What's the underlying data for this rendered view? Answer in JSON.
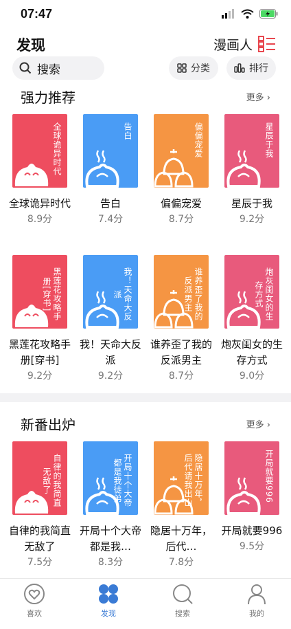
{
  "status": {
    "time": "07:47"
  },
  "header": {
    "title": "发现",
    "manhua_label": "漫画人",
    "search_placeholder": "搜索",
    "category_label": "分类",
    "rank_label": "排行"
  },
  "colors": {
    "red": "#ee4d5f",
    "blue": "#4a9cf5",
    "orange": "#f59543",
    "pink": "#e85a7c",
    "accent": "#3a7bd5"
  },
  "sections": [
    {
      "title": "强力推荐",
      "more": "更多",
      "books": [
        {
          "cover_title": "全球诡异时代",
          "name": "全球诡异时代",
          "score": "8.9分",
          "color": "red",
          "icon": "bun-icon"
        },
        {
          "cover_title": "告白",
          "name": "告白",
          "score": "7.4分",
          "color": "blue",
          "icon": "steaming-bun-icon"
        },
        {
          "cover_title": "偏偏宠爱",
          "name": "偏偏宠爱",
          "score": "8.7分",
          "color": "orange",
          "icon": "bun-trio-icon"
        },
        {
          "cover_title": "星辰于我",
          "name": "星辰于我",
          "score": "9.2分",
          "color": "pink",
          "icon": "steaming-bun-icon"
        },
        {
          "cover_title": "黑莲花攻略手册[穿书]",
          "name": "黑莲花攻略手册[穿书]",
          "score": "9.2分",
          "color": "red",
          "icon": "bun-icon"
        },
        {
          "cover_title": "我！天命大反派",
          "name": "我！天命大反派",
          "score": "9.2分",
          "color": "blue",
          "icon": "steaming-bun-icon"
        },
        {
          "cover_title": "谁养歪了我的反派男主",
          "name": "谁养歪了我的反派男主",
          "score": "8.7分",
          "color": "orange",
          "icon": "bun-trio-icon"
        },
        {
          "cover_title": "炮灰闺女的生存方式",
          "name": "炮灰闺女的生存方式",
          "score": "9.0分",
          "color": "pink",
          "icon": "steaming-bun-icon"
        }
      ]
    },
    {
      "title": "新番出炉",
      "more": "更多",
      "books": [
        {
          "cover_title": "自律的我简直无敌了",
          "name": "自律的我简直无敌了",
          "score": "7.5分",
          "color": "red",
          "icon": "bun-icon"
        },
        {
          "cover_title": "开局十个大帝都是我徒弟",
          "name": "开局十个大帝都是我…",
          "score": "8.3分",
          "color": "blue",
          "icon": "steaming-bun-icon"
        },
        {
          "cover_title": "隐居十万年，后代请我出山",
          "name": "隐居十万年，后代…",
          "score": "7.8分",
          "color": "orange",
          "icon": "bun-trio-icon"
        },
        {
          "cover_title": "开局就要996",
          "name": "开局就要996",
          "score": "9.5分",
          "color": "pink",
          "icon": "steaming-bun-icon"
        }
      ]
    }
  ],
  "tabbar": [
    {
      "label": "喜欢",
      "icon": "heart-icon",
      "active": false
    },
    {
      "label": "发现",
      "icon": "grid-icon",
      "active": true
    },
    {
      "label": "搜索",
      "icon": "search-icon",
      "active": false
    },
    {
      "label": "我的",
      "icon": "profile-icon",
      "active": false
    }
  ]
}
